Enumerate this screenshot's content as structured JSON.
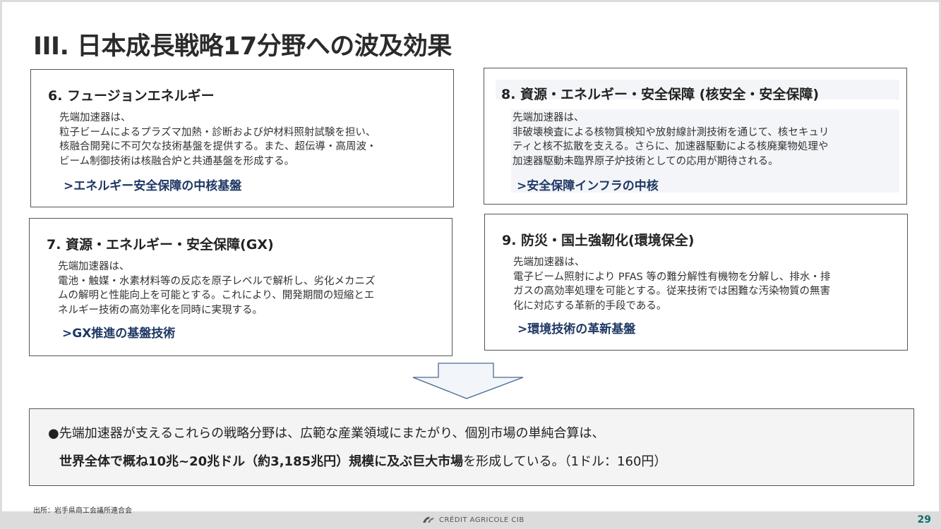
{
  "title": "III. 日本成長戦略17分野への波及効果",
  "boxes": [
    {
      "heading": "6. フュージョンエネルギー",
      "lines": [
        "先端加速器は、",
        "粒子ビームによるプラズマ加熱・診断および炉材料照射試験を担い、",
        "核融合開発に不可欠な技術基盤を提供する。また、超伝導・高周波・",
        "ビーム制御技術は核融合炉と共通基盤を形成する。"
      ],
      "tag": ">エネルギー安全保障の中核基盤"
    },
    {
      "heading": "7. 資源・エネルギー・安全保障(GX)",
      "lines": [
        "先端加速器は、",
        "電池・触媒・水素材料等の反応を原子レベルで解析し、劣化メカニズ",
        "ムの解明と性能向上を可能とする。これにより、開発期間の短縮とエ",
        "ネルギー技術の高効率化を同時に実現する。"
      ],
      "tag": ">GX推進の基盤技術"
    },
    {
      "heading": "8. 資源・エネルギー・安全保障 (核安全・安全保障)",
      "lines": [
        "先端加速器は、",
        "非破壊検査による核物質検知や放射線計測技術を通じて、核セキュリ",
        "ティと核不拡散を支える。さらに、加速器駆動による核廃棄物処理や",
        "加速器駆動未臨界原子炉技術としての応用が期待される。"
      ],
      "tag": ">安全保障インフラの中核"
    },
    {
      "heading": "9. 防災・国土強靭化(環境保全)",
      "lines": [
        "先端加速器は、",
        "電子ビーム照射により PFAS 等の難分解性有機物を分解し、排水・排",
        "ガスの高効率処理を可能とする。従来技術では困難な汚染物質の無害",
        "化に対応する革新的手段である。"
      ],
      "tag": ">環境技術の革新基盤"
    }
  ],
  "summary": {
    "line1": "●先端加速器が支えるこれらの戦略分野は、広範な産業領域にまたがり、個別市場の単純合算は、",
    "line2_bold": "世界全体で概ね10兆~20兆ドル（約3,185兆円）規模に及ぶ巨大市場",
    "line2_rest": "を形成している。（1ドル：160円）"
  },
  "source": "出所：岩手県商工会議所連合会",
  "footer": {
    "logo_text": "CRÉDIT AGRICOLE CIB",
    "page_number": "29"
  }
}
